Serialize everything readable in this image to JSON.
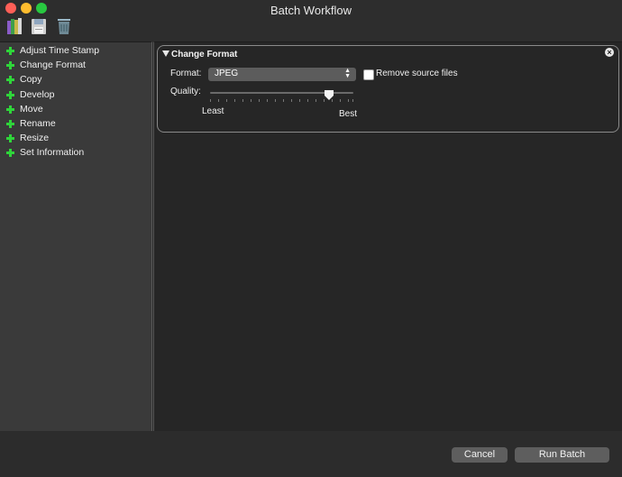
{
  "window": {
    "title": "Batch Workflow"
  },
  "toolbar": {
    "icons": [
      "library-icon",
      "save-icon",
      "trash-icon"
    ]
  },
  "sidebar": {
    "items": [
      {
        "label": "Adjust Time Stamp"
      },
      {
        "label": "Change Format"
      },
      {
        "label": "Copy"
      },
      {
        "label": "Develop"
      },
      {
        "label": "Move"
      },
      {
        "label": "Rename"
      },
      {
        "label": "Resize"
      },
      {
        "label": "Set Information"
      }
    ]
  },
  "change_format": {
    "header": "Change Format",
    "format_label": "Format:",
    "format_value": "JPEG",
    "remove_source_label": "Remove source files",
    "remove_source_checked": false,
    "quality_label": "Quality:",
    "quality_min_label": "Least",
    "quality_max_label": "Best",
    "quality_level": 0.83
  },
  "footer": {
    "cancel_label": "Cancel",
    "run_label": "Run Batch"
  },
  "colors": {
    "accent_plus": "#2fd53a",
    "button_bg": "#5e5e5e"
  }
}
